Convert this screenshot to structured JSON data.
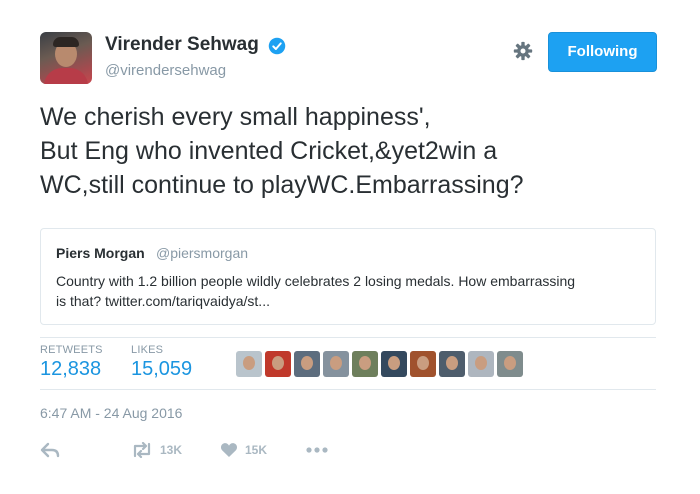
{
  "author": {
    "name": "Virender Sehwag",
    "handle": "@virendersehwag",
    "verified": true,
    "avatar_icon": "user-avatar-photo"
  },
  "header": {
    "follow_label": "Following",
    "settings_icon": "gear-icon"
  },
  "tweet": {
    "lines": [
      "We cherish every small happiness',",
      "But Eng who invented Cricket,&yet2win a",
      "WC,still continue to playWC.Embarrassing?"
    ]
  },
  "quote": {
    "name": "Piers Morgan",
    "handle": "@piersmorgan",
    "lines": [
      "Country with 1.2 billion people wildly celebrates 2 losing medals. How embarrassing",
      "is that?  twitter.com/tariqvaidya/st..."
    ]
  },
  "stats": {
    "retweets_label": "RETWEETS",
    "retweets": "12,838",
    "likes_label": "LIKES",
    "likes": "15,059",
    "liker_avatars": [
      {
        "icon": "liker-avatar-1",
        "color": "#b9c4cc"
      },
      {
        "icon": "liker-avatar-2",
        "color": "#c0392b"
      },
      {
        "icon": "liker-avatar-3",
        "color": "#5d6d7e"
      },
      {
        "icon": "liker-avatar-4",
        "color": "#85929e"
      },
      {
        "icon": "liker-avatar-5",
        "color": "#6e7f5c"
      },
      {
        "icon": "liker-avatar-6",
        "color": "#34495e"
      },
      {
        "icon": "liker-avatar-7",
        "color": "#a0522d"
      },
      {
        "icon": "liker-avatar-8",
        "color": "#4e5d6c"
      },
      {
        "icon": "liker-avatar-9",
        "color": "#aeb6bf"
      },
      {
        "icon": "liker-avatar-10",
        "color": "#7f8c8d"
      }
    ]
  },
  "timestamp": "6:47 AM - 24 Aug 2016",
  "actions": {
    "reply_icon": "reply-icon",
    "retweet_icon": "retweet-icon",
    "retweet_count": "13K",
    "like_icon": "heart-icon",
    "like_count": "15K",
    "more_icon": "more-dots-icon"
  },
  "colors": {
    "accent": "#1da1f2",
    "link": "#1b95e0",
    "muted": "#8899a6",
    "text": "#292f33",
    "border": "#e1e8ed"
  }
}
